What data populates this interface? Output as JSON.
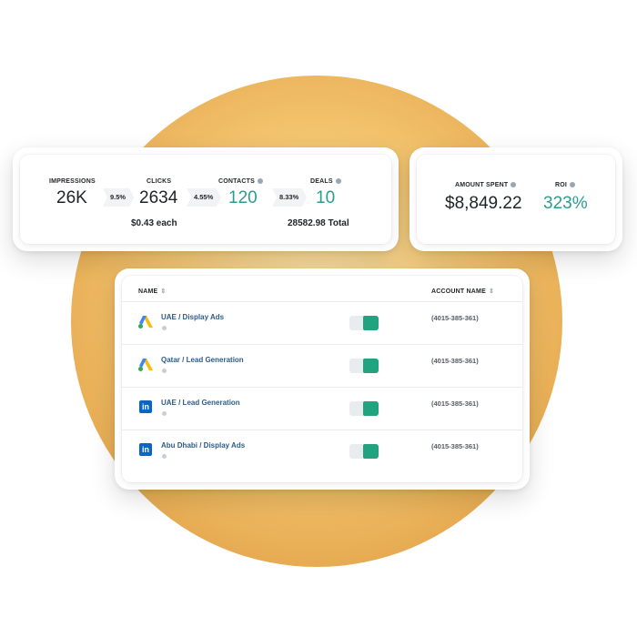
{
  "stats": {
    "impressions": {
      "label": "IMPRESSIONS",
      "value": "26K"
    },
    "impressions_to_clicks_rate": "9.5%",
    "clicks": {
      "label": "CLICKS",
      "value": "2634",
      "sub": "$0.43 each"
    },
    "clicks_to_contacts_rate": "4.55%",
    "contacts": {
      "label": "CONTACTS",
      "value": "120"
    },
    "contacts_to_deals_rate": "8.33%",
    "deals": {
      "label": "DEALS",
      "value": "10",
      "sub": "28582.98 Total"
    }
  },
  "spend": {
    "amount_spent": {
      "label": "AMOUNT SPENT",
      "value": "$8,849.22"
    },
    "roi": {
      "label": "ROI",
      "value": "323%"
    }
  },
  "table": {
    "columns": [
      "NAME",
      "ACCOUNT NAME"
    ],
    "rows": [
      {
        "name": "UAE / Display Ads",
        "platform": "google-ads",
        "enabled": true,
        "account": "(4015-385-361)"
      },
      {
        "name": "Qatar / Lead Generation",
        "platform": "google-ads",
        "enabled": true,
        "account": "(4015-385-361)"
      },
      {
        "name": "UAE / Lead Generation",
        "platform": "linkedin",
        "enabled": true,
        "account": "(4015-385-361)"
      },
      {
        "name": "Abu Dhabi / Display Ads",
        "platform": "linkedin",
        "enabled": true,
        "account": "(4015-385-361)"
      }
    ]
  },
  "icons": {
    "linkedin_glyph": "in",
    "sort": "⇕"
  },
  "colors": {
    "accent_teal": "#2a9d8f",
    "toggle_on": "#22a37f",
    "link_blue": "#2b5c8a",
    "circle": "#f3c46e"
  }
}
